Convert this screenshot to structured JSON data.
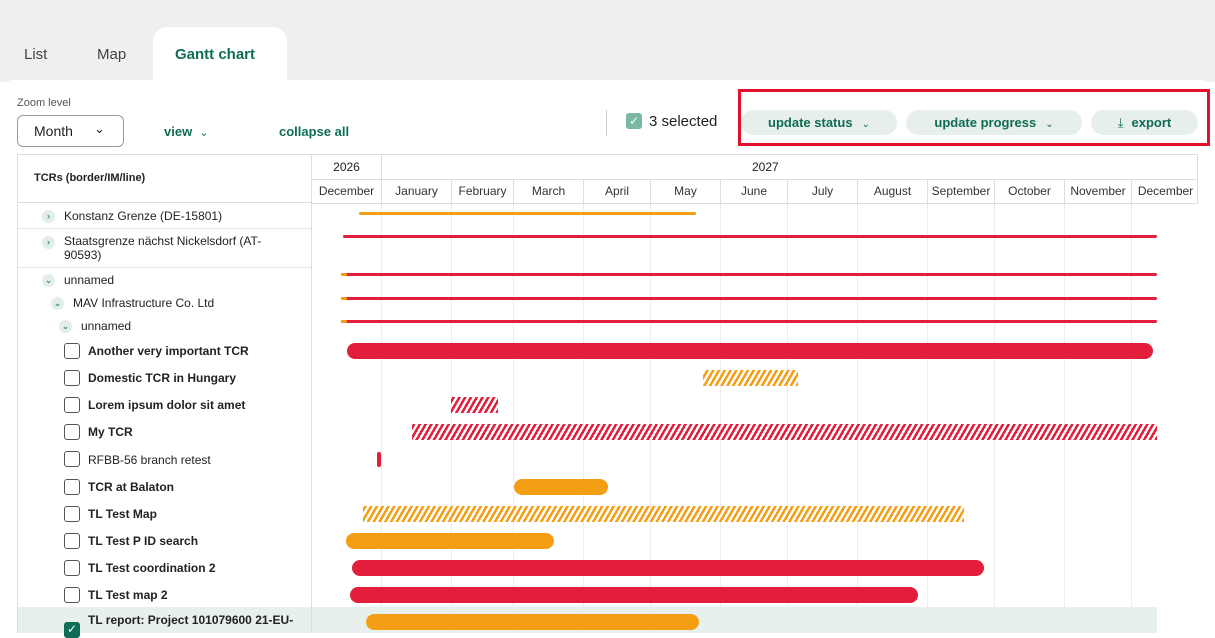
{
  "tabs": [
    {
      "label": "List"
    },
    {
      "label": "Map"
    },
    {
      "label": "Gantt chart",
      "active": true
    }
  ],
  "toolbar": {
    "zoom_label": "Zoom level",
    "zoom_value": "Month",
    "view_label": "view",
    "collapse_label": "collapse all",
    "selected_count_text": "3 selected",
    "update_status_label": "update status",
    "update_progress_label": "update progress",
    "export_label": "export"
  },
  "table": {
    "left_header": "TCRs (border/IM/line)",
    "years": [
      "2026",
      "2027"
    ],
    "months": [
      "December",
      "January",
      "February",
      "March",
      "April",
      "May",
      "June",
      "July",
      "August",
      "September",
      "October",
      "November",
      "December"
    ]
  },
  "rows": [
    {
      "label": "Konstanz Grenze (DE-15801)"
    },
    {
      "label": "Staatsgrenze nächst Nickelsdorf (AT-90593)"
    },
    {
      "label": "unnamed"
    },
    {
      "label": "MAV Infrastructure Co. Ltd"
    },
    {
      "label": "unnamed"
    },
    {
      "label": "Another very important TCR"
    },
    {
      "label": "Domestic TCR in Hungary"
    },
    {
      "label": "Lorem ipsum dolor sit amet"
    },
    {
      "label": "My TCR"
    },
    {
      "label": "RFBB-56 branch retest"
    },
    {
      "label": "TCR at Balaton"
    },
    {
      "label": "TL Test Map"
    },
    {
      "label": "TL Test P ID search"
    },
    {
      "label": "TL Test coordination 2"
    },
    {
      "label": "TL Test map 2"
    },
    {
      "label": "TL report: Project 101079600 21-EU-"
    }
  ],
  "colors": {
    "accent": "#0f6d55",
    "bar_red": "#e31e3a",
    "bar_orange": "#f49e14",
    "highlight_box": "#e3102b"
  },
  "icons": {
    "chevron": "chevron-down-icon",
    "expand": "chevron-right-icon",
    "export": "download-icon",
    "check": "check-icon"
  }
}
